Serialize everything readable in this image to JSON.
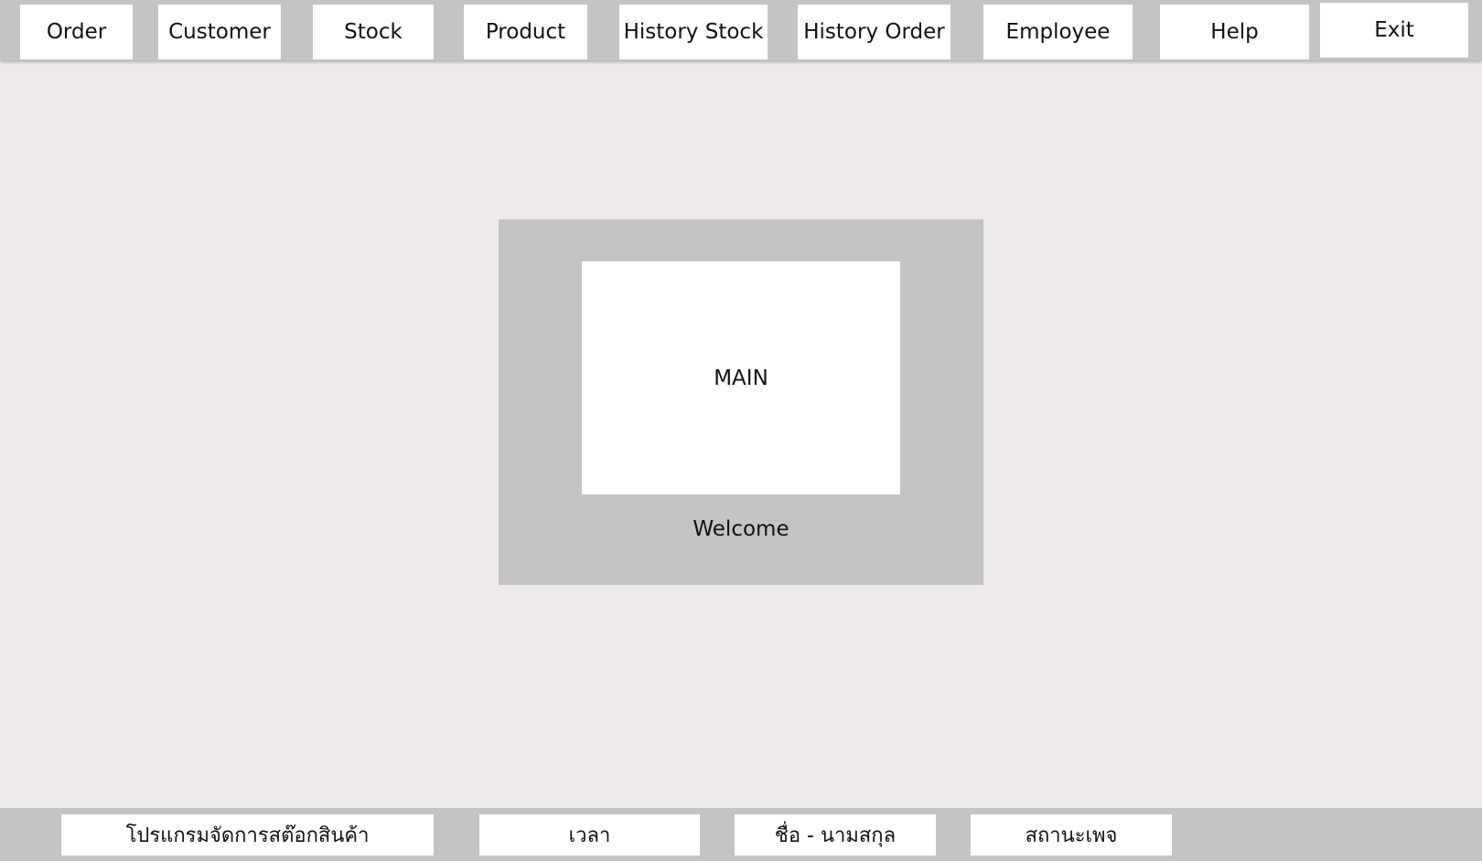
{
  "nav": {
    "order": "Order",
    "customer": "Customer",
    "stock": "Stock",
    "product": "Product",
    "history_stock": "History Stock",
    "history_order": "History Order",
    "employee": "Employee",
    "help": "Help",
    "exit": "Exit"
  },
  "main": {
    "title": "MAIN",
    "welcome": "Welcome"
  },
  "status": {
    "program_name": "โปรแกรมจัดการสต๊อกสินค้า",
    "time": "เวลา",
    "full_name": "ชื่อ - นามสกุล",
    "status": "สถานะเพจ"
  }
}
